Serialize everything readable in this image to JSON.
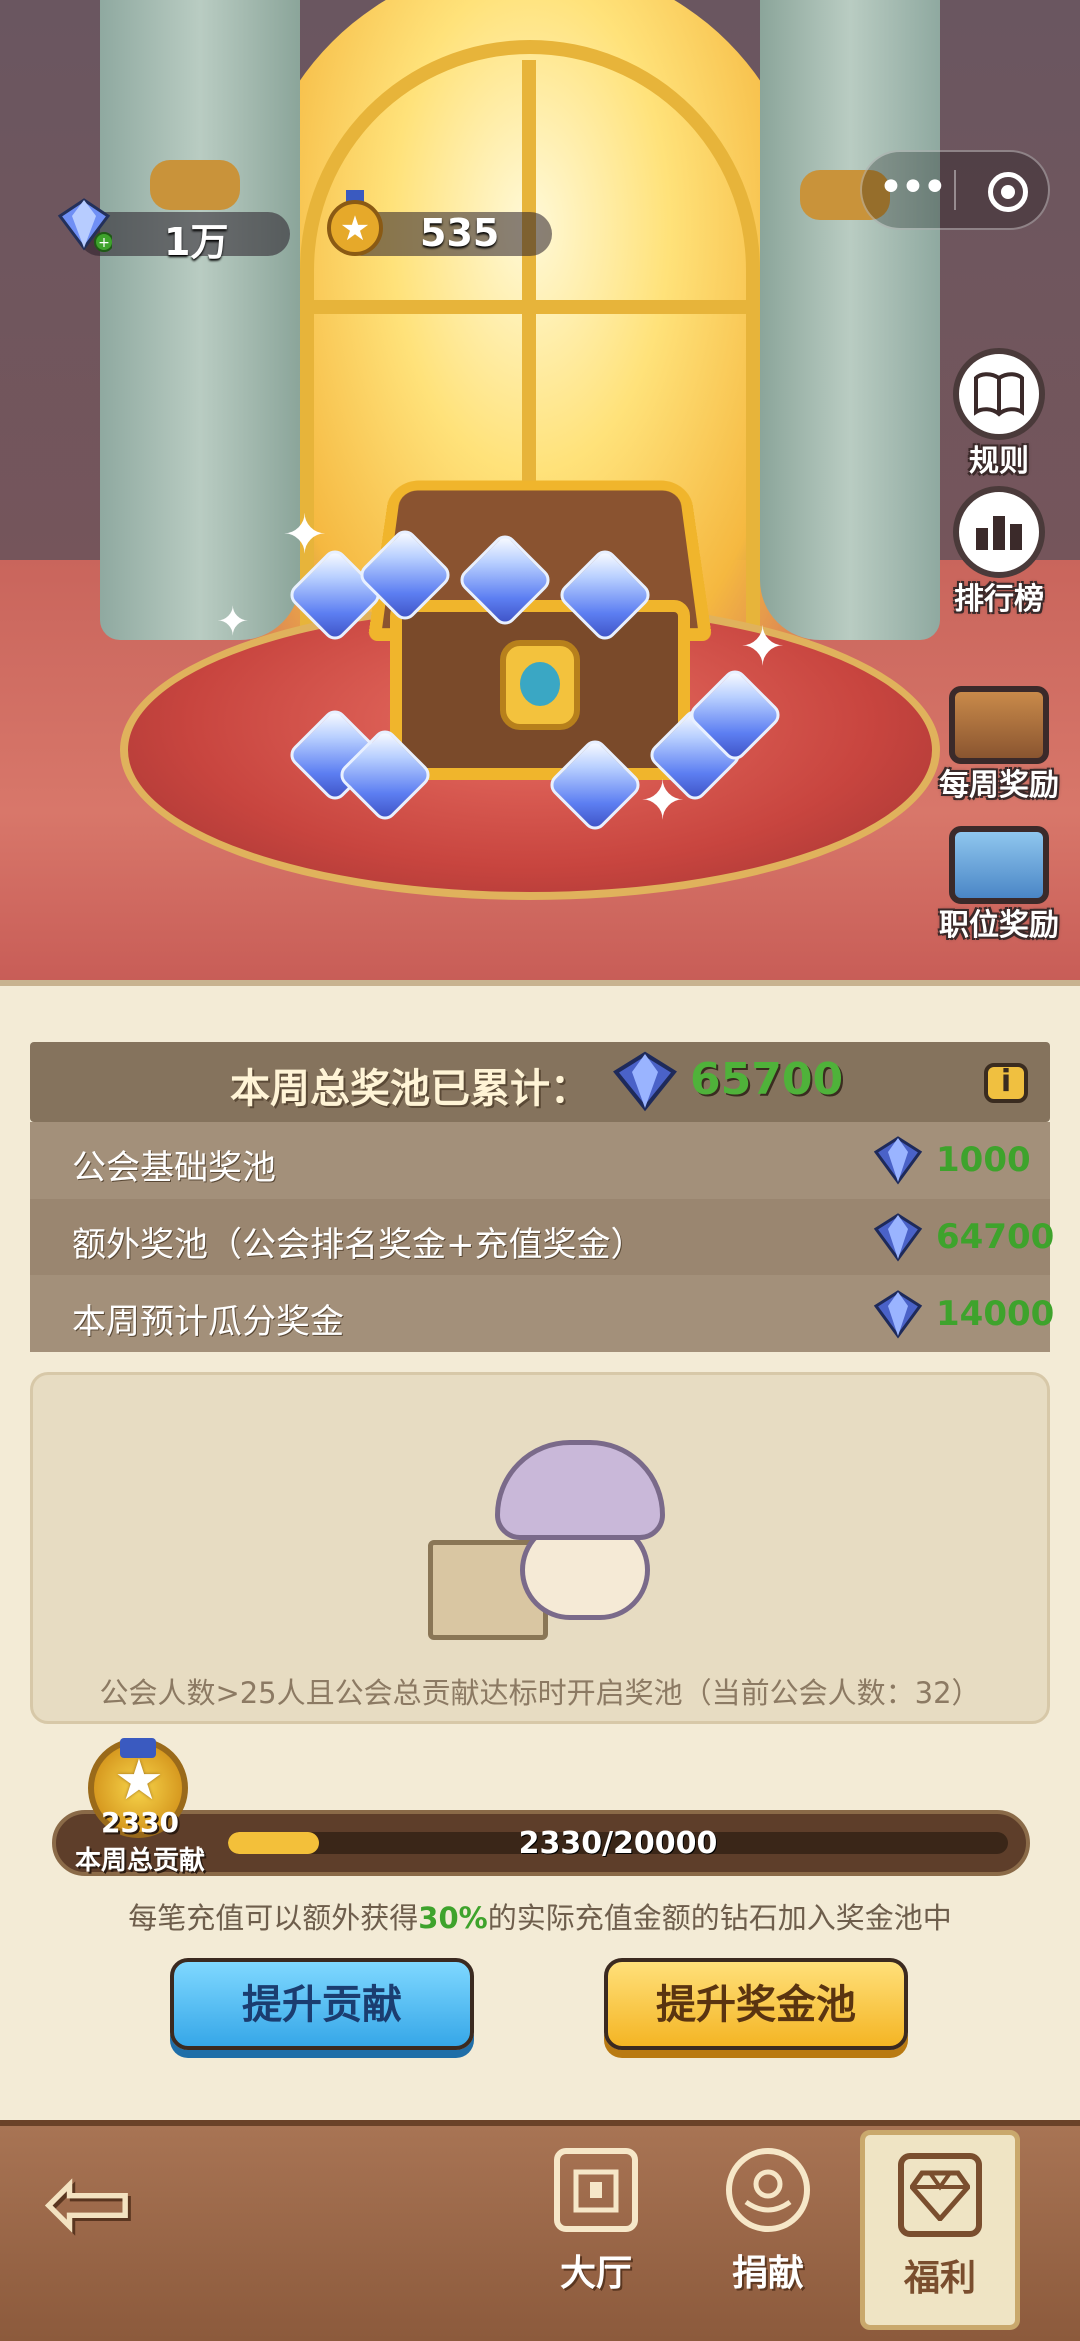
{
  "header": {
    "diamonds": "1万",
    "medals": "535"
  },
  "side_menu": [
    {
      "label": "规则",
      "icon": "rules-book-icon"
    },
    {
      "label": "排行榜",
      "icon": "leaderboard-icon"
    },
    {
      "label": "每周奖励",
      "icon": "weekly-reward-chest-icon"
    },
    {
      "label": "职位奖励",
      "icon": "position-reward-chest-icon"
    }
  ],
  "pool": {
    "title": "本周总奖池已累计：",
    "total": "65700",
    "rows": [
      {
        "label": "公会基础奖池",
        "value": "1000"
      },
      {
        "label": "额外奖池（公会排名奖金+充值奖金）",
        "value": "64700"
      },
      {
        "label": "本周预计瓜分奖金",
        "value": "14000"
      }
    ]
  },
  "empty_state": {
    "message": "公会人数>25人且公会总贡献达标时开启奖池（当前公会人数：32）"
  },
  "contribution": {
    "value": "2330",
    "label": "本周总贡献",
    "progress_text": "2330/20000",
    "progress": 0.1165
  },
  "bonus_note": {
    "before": "每笔充值可以额外获得",
    "highlight": "30%",
    "after": "的实际充值金额的钻石加入奖金池中"
  },
  "buttons": {
    "boost_contribution": "提升贡献",
    "boost_pool": "提升奖金池"
  },
  "nav": {
    "items": [
      {
        "label": "大厅",
        "icon": "hall-icon",
        "active": false
      },
      {
        "label": "捐献",
        "icon": "donate-icon",
        "active": false
      },
      {
        "label": "福利",
        "icon": "diamond-icon",
        "active": true
      }
    ]
  },
  "colors": {
    "accent_green": "#3ea32c",
    "gold": "#f3c03a",
    "panel_bg": "#f3ebd6"
  }
}
